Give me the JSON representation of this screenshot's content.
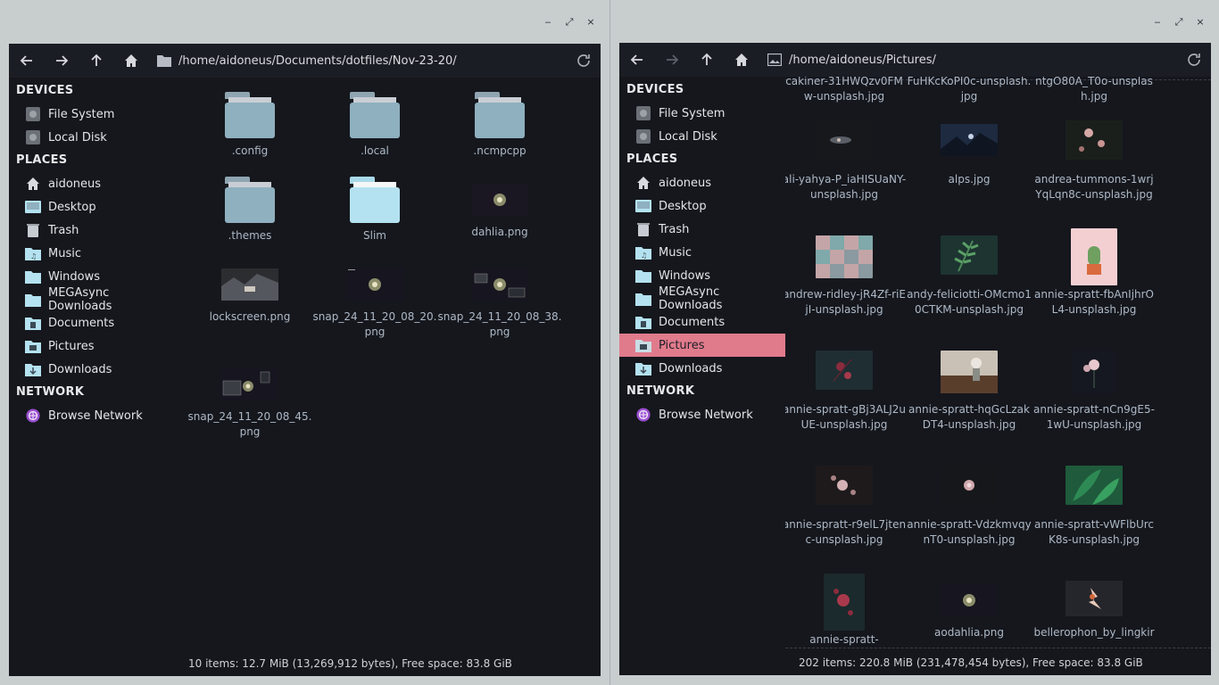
{
  "window_controls": {
    "minimize": "‒",
    "maximize": "⤢",
    "close": "×"
  },
  "left": {
    "path": "/home/aidoneus/Documents/dotfiles/Nov-23-20/",
    "sections": {
      "devices": "DEVICES",
      "places": "PLACES",
      "network": "NETWORK"
    },
    "devices": [
      "File System",
      "Local Disk"
    ],
    "places": [
      "aidoneus",
      "Desktop",
      "Trash",
      "Music",
      "Windows",
      "MEGAsync Downloads",
      "Documents",
      "Pictures",
      "Downloads"
    ],
    "network": [
      "Browse Network"
    ],
    "files": [
      ".config",
      ".local",
      ".ncmpcpp",
      ".themes",
      "Slim",
      "dahlia.png",
      "lockscreen.png",
      "snap_24_11_20_08_20.png",
      "snap_24_11_20_08_38.png",
      "snap_24_11_20_08_45.png"
    ],
    "status": "10 items: 12.7 MiB (13,269,912 bytes), Free space: 83.8 GiB"
  },
  "right": {
    "path": "/home/aidoneus/Pictures/",
    "sections": {
      "devices": "DEVICES",
      "places": "PLACES",
      "network": "NETWORK"
    },
    "devices": [
      "File System",
      "Local Disk"
    ],
    "places": [
      "aidoneus",
      "Desktop",
      "Trash",
      "Music",
      "Windows",
      "MEGAsync Downloads",
      "Documents",
      "Pictures",
      "Downloads"
    ],
    "active_place": "Pictures",
    "network": [
      "Browse Network"
    ],
    "files": [
      "cakiner-31HWQzv0FMw-unsplash.jpg",
      "FuHKcKoPI0c-unsplash.jpg",
      "ntgO80A_T0o-unsplash.jpg",
      "ali-yahya-P_iaHISUaNY-unsplash.jpg",
      "alps.jpg",
      "andrea-tummons-1wrjYqLqn8c-unsplash.jpg",
      "andrew-ridley-jR4Zf-riEjI-unsplash.jpg",
      "andy-feliciotti-OMcmo10CTKM-unsplash.jpg",
      "annie-spratt-fbAnIjhrOL4-unsplash.jpg",
      "annie-spratt-gBj3ALJ2uUE-unsplash.jpg",
      "annie-spratt-hqGcLzakDT4-unsplash.jpg",
      "annie-spratt-nCn9gE5-1wU-unsplash.jpg",
      "annie-spratt-r9elL7jtenc-unsplash.jpg",
      "annie-spratt-VdzkmvqynT0-unsplash.jpg",
      "annie-spratt-vWFlbUrcK8s-unsplash.jpg",
      "annie-spratt-",
      "aodahlia.png",
      "bellerophon_by_lingkir"
    ],
    "status": "202 items: 220.8 MiB (231,478,454 bytes), Free space: 83.8 GiB"
  },
  "colors": {
    "accent": "#e07b8c",
    "window_bg": "#15171d",
    "folder": "#8fb0bf"
  }
}
